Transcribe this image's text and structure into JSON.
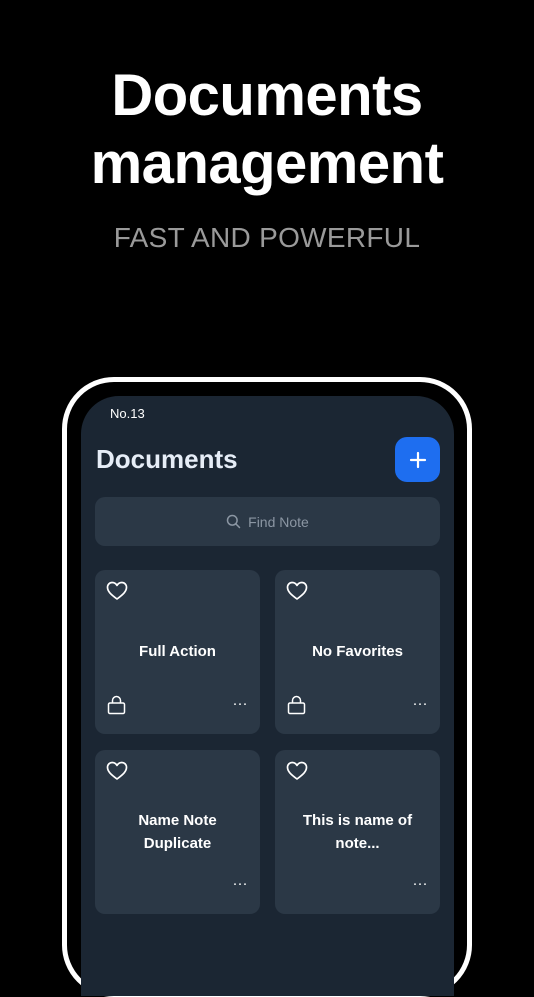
{
  "promo": {
    "headline_line1": "Documents",
    "headline_line2": "management",
    "subheadline": "FAST AND POWERFUL"
  },
  "app": {
    "status_text": "No.13",
    "title": "Documents",
    "add_icon": "plus-icon",
    "search": {
      "placeholder": "Find Note",
      "icon": "search-icon"
    },
    "cards": [
      {
        "name": "Full Action",
        "locked": true,
        "favorite": false
      },
      {
        "name": "No Favorites",
        "locked": true,
        "favorite": false
      },
      {
        "name": "Name Note Duplicate",
        "locked": false,
        "favorite": false
      },
      {
        "name": "This is name of note...",
        "locked": false,
        "favorite": false
      }
    ],
    "more_label": "···"
  },
  "colors": {
    "background": "#000000",
    "screen": "#1b2633",
    "card": "#2b3846",
    "accent": "#1e6ef0",
    "subheadline": "#9a9a9a"
  }
}
